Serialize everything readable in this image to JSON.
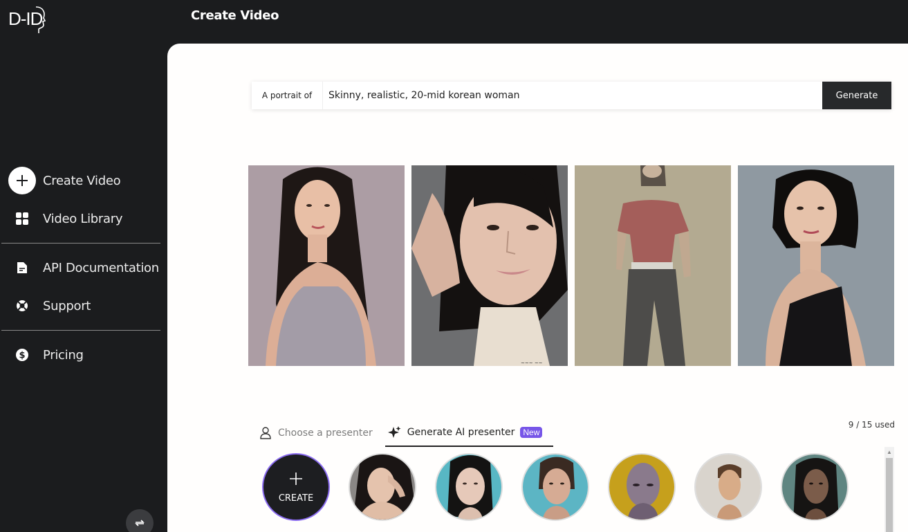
{
  "app": {
    "logo_text": "D-ID",
    "page_title": "Create Video"
  },
  "sidebar": {
    "items": [
      {
        "label": "Create Video",
        "icon": "plus-icon"
      },
      {
        "label": "Video Library",
        "icon": "grid-icon"
      },
      {
        "label": "API Documentation",
        "icon": "document-icon"
      },
      {
        "label": "Support",
        "icon": "lifebuoy-icon"
      },
      {
        "label": "Pricing",
        "icon": "dollar-icon"
      }
    ],
    "collapse_icon": "swap-arrow-icon"
  },
  "prompt": {
    "prefix": "A portrait of",
    "value": "Skinny, realistic, 20-mid korean woman",
    "generate_label": "Generate"
  },
  "results": [
    {
      "alt": "generated-portrait-1"
    },
    {
      "alt": "generated-portrait-2"
    },
    {
      "alt": "generated-portrait-3"
    },
    {
      "alt": "generated-portrait-4"
    }
  ],
  "tabs": {
    "choose_label": "Choose a presenter",
    "generate_label": "Generate AI presenter",
    "badge": "New"
  },
  "usage": "9 / 15 used",
  "presenters": {
    "create_label": "CREATE"
  },
  "colors": {
    "sidebar_bg": "#1b1c1e",
    "accent_purple": "#7756e8",
    "button_dark": "#27292b"
  }
}
